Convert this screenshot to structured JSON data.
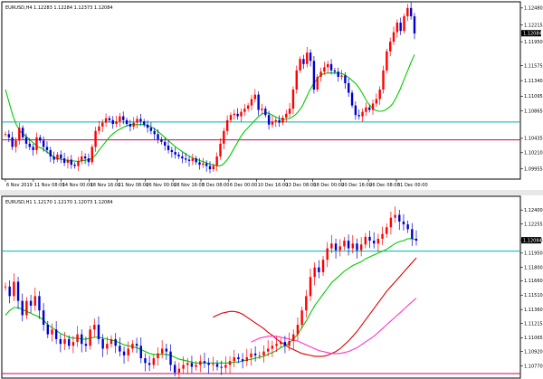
{
  "chart_data": [
    {
      "type": "candlestick",
      "title": "EURUSD,H4  1.12283 1.12284 1.12373 1.12084",
      "price_axis": {
        "ticks": [
          "1.12480",
          "1.12215",
          "1.11950",
          "1.11575",
          "1.11340",
          "1.11095",
          "1.10865",
          "1.10435",
          "1.10210",
          "1.09955"
        ],
        "current_price": "1.12084",
        "range": [
          1.0988,
          1.1252
        ]
      },
      "time_axis": {
        "labels": [
          "6 Nov 2019",
          "11 Nov 08:00",
          "14 Nov 00:00",
          "18 Nov 16:00",
          "21 Nov 08:00",
          "26 Nov 00:00",
          "28 Nov 16:00",
          "3 Dec 08:00",
          "6 Dec 00:00",
          "10 Dec 16:00",
          "13 Dec 08:00",
          "18 Dec 00:00",
          "20 Dec 16:00",
          "26 Dec 08:00",
          "31 Dec 00:00"
        ]
      },
      "series": [
        {
          "color": "#ff0000",
          "note": "close path",
          "values": [
            1.105,
            1.1045,
            1.103,
            1.104,
            1.106,
            1.1045,
            1.1035,
            1.103,
            1.1025,
            1.1045,
            1.104,
            1.103,
            1.1025,
            1.1015,
            1.101,
            1.1018,
            1.1012,
            1.1005,
            1.101,
            1.1002,
            1.1,
            1.1008,
            1.1015,
            1.1012,
            1.1006,
            1.103,
            1.1055,
            1.1062,
            1.1068,
            1.1075,
            1.1072,
            1.1066,
            1.107,
            1.1078,
            1.1072,
            1.1066,
            1.1062,
            1.1068,
            1.1074,
            1.107,
            1.1065,
            1.106,
            1.1055,
            1.105,
            1.1042,
            1.1038,
            1.1032,
            1.1025,
            1.1022,
            1.1018,
            1.1015,
            1.1012,
            1.101,
            1.1008,
            1.1012,
            1.1006,
            1.1002,
            1.1004,
            1.1,
            1.0995,
            1.1,
            1.1015,
            1.1035,
            1.1055,
            1.1072,
            1.108,
            1.1082,
            1.1078,
            1.1085,
            1.109,
            1.1095,
            1.1105,
            1.1112,
            1.1088,
            1.109,
            1.108,
            1.1065,
            1.107,
            1.1072,
            1.1068,
            1.1076,
            1.1082,
            1.109,
            1.112,
            1.115,
            1.1168,
            1.116,
            1.1178,
            1.1165,
            1.112,
            1.114,
            1.1148,
            1.1155,
            1.116,
            1.115,
            1.1148,
            1.114,
            1.1142,
            1.113,
            1.1115,
            1.1095,
            1.108,
            1.1078,
            1.1085,
            1.1092,
            1.1088,
            1.1098,
            1.1105,
            1.112,
            1.115,
            1.118,
            1.1195,
            1.121,
            1.1225,
            1.1212,
            1.1235,
            1.1248,
            1.1235,
            1.1208
          ]
        },
        {
          "color": "#00cc00",
          "name": "",
          "values": [
            1.112,
            1.11,
            1.108,
            1.1065,
            1.1055,
            1.105,
            1.1045,
            1.104,
            1.1035,
            1.103,
            1.1028,
            1.1024,
            1.102,
            1.1016,
            1.1012,
            1.1011,
            1.101,
            1.1009,
            1.1008,
            1.1008,
            1.1007,
            1.1008,
            1.1009,
            1.101,
            1.1012,
            1.1018,
            1.1026,
            1.1033,
            1.104,
            1.1047,
            1.1052,
            1.1056,
            1.1059,
            1.1062,
            1.1064,
            1.1065,
            1.1065,
            1.1065,
            1.1065,
            1.1064,
            1.1062,
            1.1059,
            1.1055,
            1.105,
            1.1045,
            1.104,
            1.1035,
            1.103,
            1.1026,
            1.1022,
            1.1018,
            1.1015,
            1.1012,
            1.101,
            1.1008,
            1.1006,
            1.1004,
            1.1002,
            1.1001,
            1.1,
            1.1002,
            1.1008,
            1.1016,
            1.1026,
            1.1036,
            1.1046,
            1.1054,
            1.106,
            1.1066,
            1.1072,
            1.1078,
            1.1082,
            1.1084,
            1.1082,
            1.1079,
            1.1076,
            1.1074,
            1.1073,
            1.1074,
            1.1076,
            1.108,
            1.1086,
            1.1094,
            1.1106,
            1.1118,
            1.1128,
            1.1136,
            1.1142,
            1.1145,
            1.1146,
            1.1146,
            1.1146,
            1.1146,
            1.1145,
            1.1142,
            1.1138,
            1.1133,
            1.1128,
            1.112,
            1.111,
            1.11,
            1.1093,
            1.1088,
            1.1086,
            1.1086,
            1.1088,
            1.1092,
            1.1098,
            1.1108,
            1.112,
            1.1134,
            1.1148,
            1.1162,
            1.1175
          ]
        }
      ],
      "horizontal_lines": [
        {
          "value": 1.1069,
          "color": "#00b3b3"
        },
        {
          "value": 1.1041,
          "color": "#cc0066"
        }
      ]
    },
    {
      "type": "candlestick",
      "title": "EURUSD,H1  1.12170 1.12170 1.12073 1.12084",
      "price_axis": {
        "ticks": [
          "1.12400",
          "1.12255",
          "1.12084",
          "1.11950",
          "1.11800",
          "1.11660",
          "1.11510",
          "1.11360",
          "1.11215",
          "1.11065",
          "1.10920",
          "1.10770"
        ],
        "current_price": "1.12084",
        "range": [
          1.1068,
          1.1244
        ]
      },
      "series": [
        {
          "color": "#ff0000",
          "note": "close path",
          "values": [
            1.116,
            1.115,
            1.1165,
            1.1145,
            1.113,
            1.1145,
            1.114,
            1.115,
            1.1135,
            1.112,
            1.111,
            1.1115,
            1.1105,
            1.11,
            1.1105,
            1.1098,
            1.1102,
            1.111,
            1.11,
            1.1098,
            1.1115,
            1.112,
            1.1105,
            1.1095,
            1.11,
            1.1105,
            1.1098,
            1.1092,
            1.1088,
            1.1095,
            1.11,
            1.1098,
            1.1085,
            1.108,
            1.1078,
            1.1085,
            1.109,
            1.1095,
            1.1092,
            1.1078,
            1.107,
            1.1074,
            1.1078,
            1.108,
            1.1076,
            1.1078,
            1.1082,
            1.108,
            1.1078,
            1.1079,
            1.1076,
            1.1075,
            1.1078,
            1.1082,
            1.1086,
            1.1084,
            1.1082,
            1.1086,
            1.109,
            1.1088,
            1.1088,
            1.1092,
            1.1095,
            1.1098,
            1.11,
            1.1102,
            1.1098,
            1.1103,
            1.111,
            1.112,
            1.1135,
            1.115,
            1.117,
            1.118,
            1.1175,
            1.1188,
            1.12,
            1.1205,
            1.1198,
            1.1202,
            1.1208,
            1.12,
            1.1205,
            1.1198,
            1.1204,
            1.1212,
            1.1208,
            1.1205,
            1.121,
            1.1215,
            1.1222,
            1.1232,
            1.1235,
            1.1228,
            1.1225,
            1.122,
            1.121,
            1.1208
          ]
        },
        {
          "color": "#00cc00",
          "values": [
            1.113,
            1.1135,
            1.1138,
            1.1138,
            1.1136,
            1.1134,
            1.1132,
            1.113,
            1.1128,
            1.1125,
            1.112,
            1.1117,
            1.1114,
            1.1111,
            1.1109,
            1.1107,
            1.1106,
            1.1106,
            1.1105,
            1.1105,
            1.1106,
            1.1107,
            1.1107,
            1.1106,
            1.1105,
            1.1104,
            1.1103,
            1.1101,
            1.1099,
            1.1098,
            1.1097,
            1.1096,
            1.1094,
            1.1092,
            1.109,
            1.1089,
            1.1089,
            1.1089,
            1.1089,
            1.1088,
            1.1086,
            1.1084,
            1.1083,
            1.1082,
            1.1081,
            1.108,
            1.108,
            1.108,
            1.108,
            1.108,
            1.108,
            1.108,
            1.108,
            1.108,
            1.1081,
            1.1081,
            1.1082,
            1.1083,
            1.1084,
            1.1085,
            1.1086,
            1.1087,
            1.1089,
            1.1091,
            1.1093,
            1.1096,
            1.1098,
            1.1101,
            1.1105,
            1.111,
            1.1117,
            1.1124,
            1.1132,
            1.114,
            1.1146,
            1.1152,
            1.1158,
            1.1164,
            1.1168,
            1.1172,
            1.1176,
            1.1179,
            1.1182,
            1.1184,
            1.1186,
            1.1189,
            1.1191,
            1.1193,
            1.1195,
            1.1197,
            1.1199,
            1.1202,
            1.1205,
            1.1207,
            1.1208,
            1.121,
            1.121,
            1.1209
          ]
        },
        {
          "color": "#dd0000",
          "values": [
            1.1128,
            1.113,
            1.1132,
            1.1133,
            1.1134,
            1.1134,
            1.1133,
            1.1131,
            1.1128,
            1.1125,
            1.1122,
            1.1119,
            1.1116,
            1.1112,
            1.1109,
            1.1105,
            1.1102,
            1.1099,
            1.1096,
            1.1094,
            1.1092,
            1.109,
            1.1089,
            1.1088,
            1.1087,
            1.1087,
            1.1087,
            1.1088,
            1.109,
            1.1092,
            1.1095,
            1.1099,
            1.1103,
            1.1108,
            1.1113,
            1.1119,
            1.1125,
            1.1131,
            1.1137,
            1.1143,
            1.1149,
            1.1155,
            1.116,
            1.1165,
            1.117,
            1.1175,
            1.118,
            1.1185,
            1.119
          ]
        },
        {
          "color": "#ff33cc",
          "values": [
            1.1102,
            1.1104,
            1.1106,
            1.1107,
            1.1108,
            1.1108,
            1.1108,
            1.1107,
            1.1106,
            1.1105,
            1.1104,
            1.1103,
            1.1101,
            1.1099,
            1.1097,
            1.1095,
            1.1093,
            1.1092,
            1.1091,
            1.109,
            1.109,
            1.109,
            1.1091,
            1.1092,
            1.1094,
            1.1096,
            1.1099,
            1.1102,
            1.1105,
            1.1108,
            1.1112,
            1.1116,
            1.112,
            1.1124,
            1.1128,
            1.1132,
            1.1136,
            1.114,
            1.1144,
            1.1148
          ]
        }
      ],
      "horizontal_lines": [
        {
          "value": 1.1197,
          "color": "#00b3b3"
        },
        {
          "value": 1.1069,
          "color": "#cc0066"
        }
      ]
    }
  ]
}
